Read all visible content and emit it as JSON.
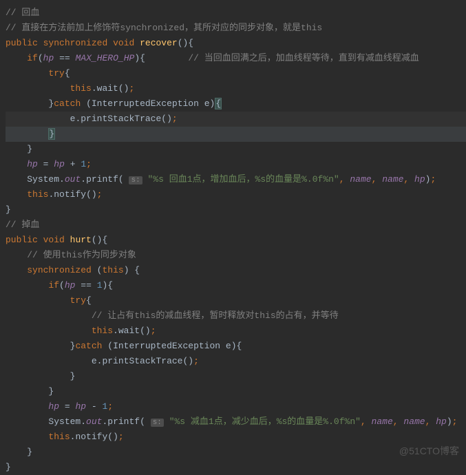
{
  "code": {
    "c1": "// 回血",
    "c2": "// 直接在方法前加上修饰符synchronized，其所对应的同步对象，就是this",
    "kw_public": "public",
    "kw_synchronized": "synchronized",
    "kw_void": "void",
    "m_recover": "recover",
    "kw_if": "if",
    "id_hp": "hp",
    "op_eq": "==",
    "const_max": "MAX_HERO_HP",
    "c3": "// 当回血回满之后，加血线程等待，直到有减血线程减血",
    "kw_try": "try",
    "kw_this": "this",
    "m_wait": "wait",
    "kw_catch": "catch",
    "ex_interrupted": "InterruptedException",
    "id_e": "e",
    "m_printStackTrace": "printStackTrace",
    "op_plus": "+",
    "num_1": "1",
    "id_System": "System",
    "id_out": "out",
    "m_printf": "printf",
    "hint_s": "s:",
    "str_recover": "\"%s 回血1点，增加血后，%s的血量是%.0f%n\"",
    "id_name": "name",
    "m_notify": "notify",
    "c4": "// 掉血",
    "m_hurt": "hurt",
    "c5": "// 使用this作为同步对象",
    "c6": "// 让占有this的减血线程，暂时释放对this的占有，并等待",
    "op_minus": "-",
    "str_hurt": "\"%s 减血1点，减少血后，%s的血量是%.0f%n\""
  },
  "watermark": "@51CTO博客"
}
